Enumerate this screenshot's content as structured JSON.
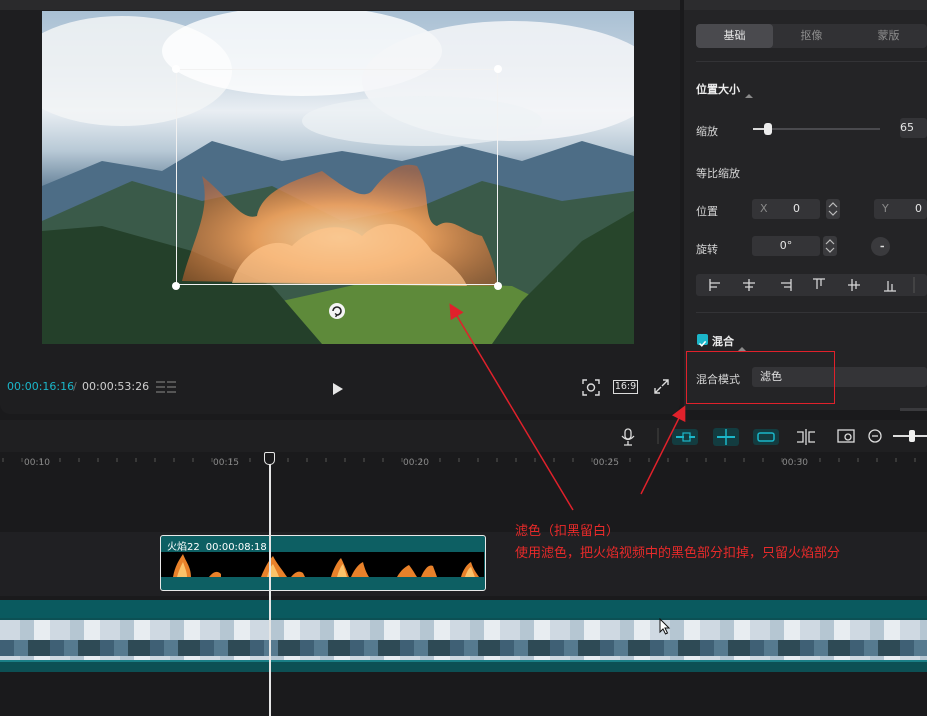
{
  "player": {
    "time_current": "00:00:16:16",
    "time_total": "00:00:53:26",
    "aspect_ratio": "16:9"
  },
  "panel": {
    "tabs": [
      {
        "label": "基础",
        "active": true
      },
      {
        "label": "抠像"
      },
      {
        "label": "蒙版"
      }
    ],
    "position_size": {
      "title": "位置大小",
      "scale_label": "缩放",
      "scale_value": "65",
      "scale_fraction": 0.12,
      "uniform_scale_label": "等比缩放",
      "position_label": "位置",
      "x_label": "X",
      "x_value": "0",
      "y_label": "Y",
      "y_value": "0",
      "rotation_label": "旋转",
      "rotation_value": "0°"
    },
    "blend": {
      "title": "混合",
      "enabled": true,
      "mode_label": "混合模式",
      "mode_value": "滤色"
    }
  },
  "timeline": {
    "ticks": [
      "00:10",
      "00:15",
      "00:20",
      "00:25",
      "00:30"
    ],
    "clip": {
      "name": "火焰22",
      "duration": "00:00:08:18"
    }
  },
  "annotation": {
    "line1": "滤色（扣黑留白）",
    "line2": "使用滤色，把火焰视频中的黑色部分扣掉，只留火焰部分",
    "color": "#e82a2a"
  },
  "colors": {
    "accent": "#1bb6c9",
    "clip": "#0d5f63"
  }
}
